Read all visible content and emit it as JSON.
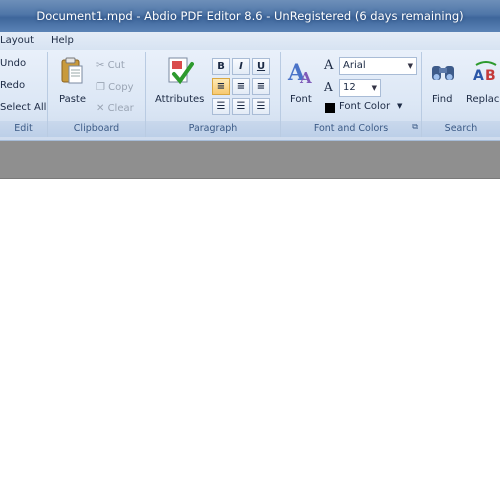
{
  "window": {
    "title": "Document1.mpd - Abdio PDF Editor 8.6 - UnRegistered (6 days remaining)"
  },
  "menu": {
    "items": [
      "Layout",
      "Help"
    ]
  },
  "ribbon": {
    "edit": {
      "undo": "Undo",
      "redo": "Redo",
      "select_all": "Select All",
      "label": "Edit"
    },
    "clipboard": {
      "paste": "Paste",
      "cut": "Cut",
      "copy": "Copy",
      "clear": "Clear",
      "label": "Clipboard"
    },
    "paragraph": {
      "attributes": "Attributes",
      "bold": "B",
      "italic": "I",
      "underline": "U",
      "label": "Paragraph"
    },
    "font": {
      "font_button": "Font",
      "font_name": "Arial",
      "font_size": "12",
      "font_color": "Font Color",
      "font_color_value": "#000000",
      "label": "Font and Colors"
    },
    "search": {
      "find": "Find",
      "replace": "Replace",
      "label": "Search"
    }
  }
}
